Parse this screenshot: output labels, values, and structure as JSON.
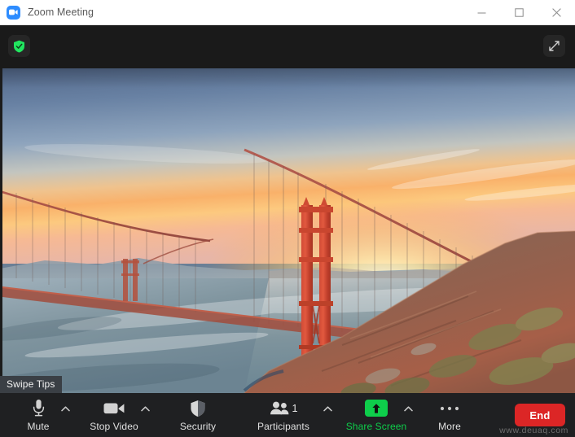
{
  "window": {
    "app_icon": "zoom-video-icon",
    "title": "Zoom Meeting",
    "controls": {
      "minimize": "minimize-icon",
      "maximize": "maximize-icon",
      "close": "close-icon"
    }
  },
  "meeting_header": {
    "security_badge": "shield-check-icon",
    "expand_button": "expand-fullscreen-icon"
  },
  "stage": {
    "content": "Golden Gate Bridge at sunset video feed",
    "tooltip": "Swipe Tips"
  },
  "toolbar": {
    "items": [
      {
        "label": "Mute",
        "icon": "microphone-icon",
        "has_chevron": true,
        "accent": "#e0e0e0"
      },
      {
        "label": "Stop Video",
        "icon": "video-camera-icon",
        "has_chevron": true,
        "accent": "#e0e0e0"
      },
      {
        "label": "Security",
        "icon": "shield-icon",
        "has_chevron": false,
        "accent": "#e0e0e0"
      },
      {
        "label": "Participants",
        "icon": "people-icon",
        "has_chevron": true,
        "accent": "#e0e0e0",
        "count": "1"
      },
      {
        "label": "Share Screen",
        "icon": "share-arrow-up-icon",
        "has_chevron": true,
        "accent": "#0ece4b"
      },
      {
        "label": "More",
        "icon": "ellipsis-icon",
        "has_chevron": false,
        "accent": "#e0e0e0"
      }
    ],
    "end_button": "End",
    "watermark": "www.deuaq.com"
  },
  "colors": {
    "titlebar_bg": "#ffffff",
    "header_bg": "#1a1a1a",
    "toolbar_bg": "#1f2022",
    "accent_green": "#0ece4b",
    "end_red": "#dc2626",
    "zoom_blue": "#2d8cff",
    "tooltip_bg": "#3a3f45"
  }
}
